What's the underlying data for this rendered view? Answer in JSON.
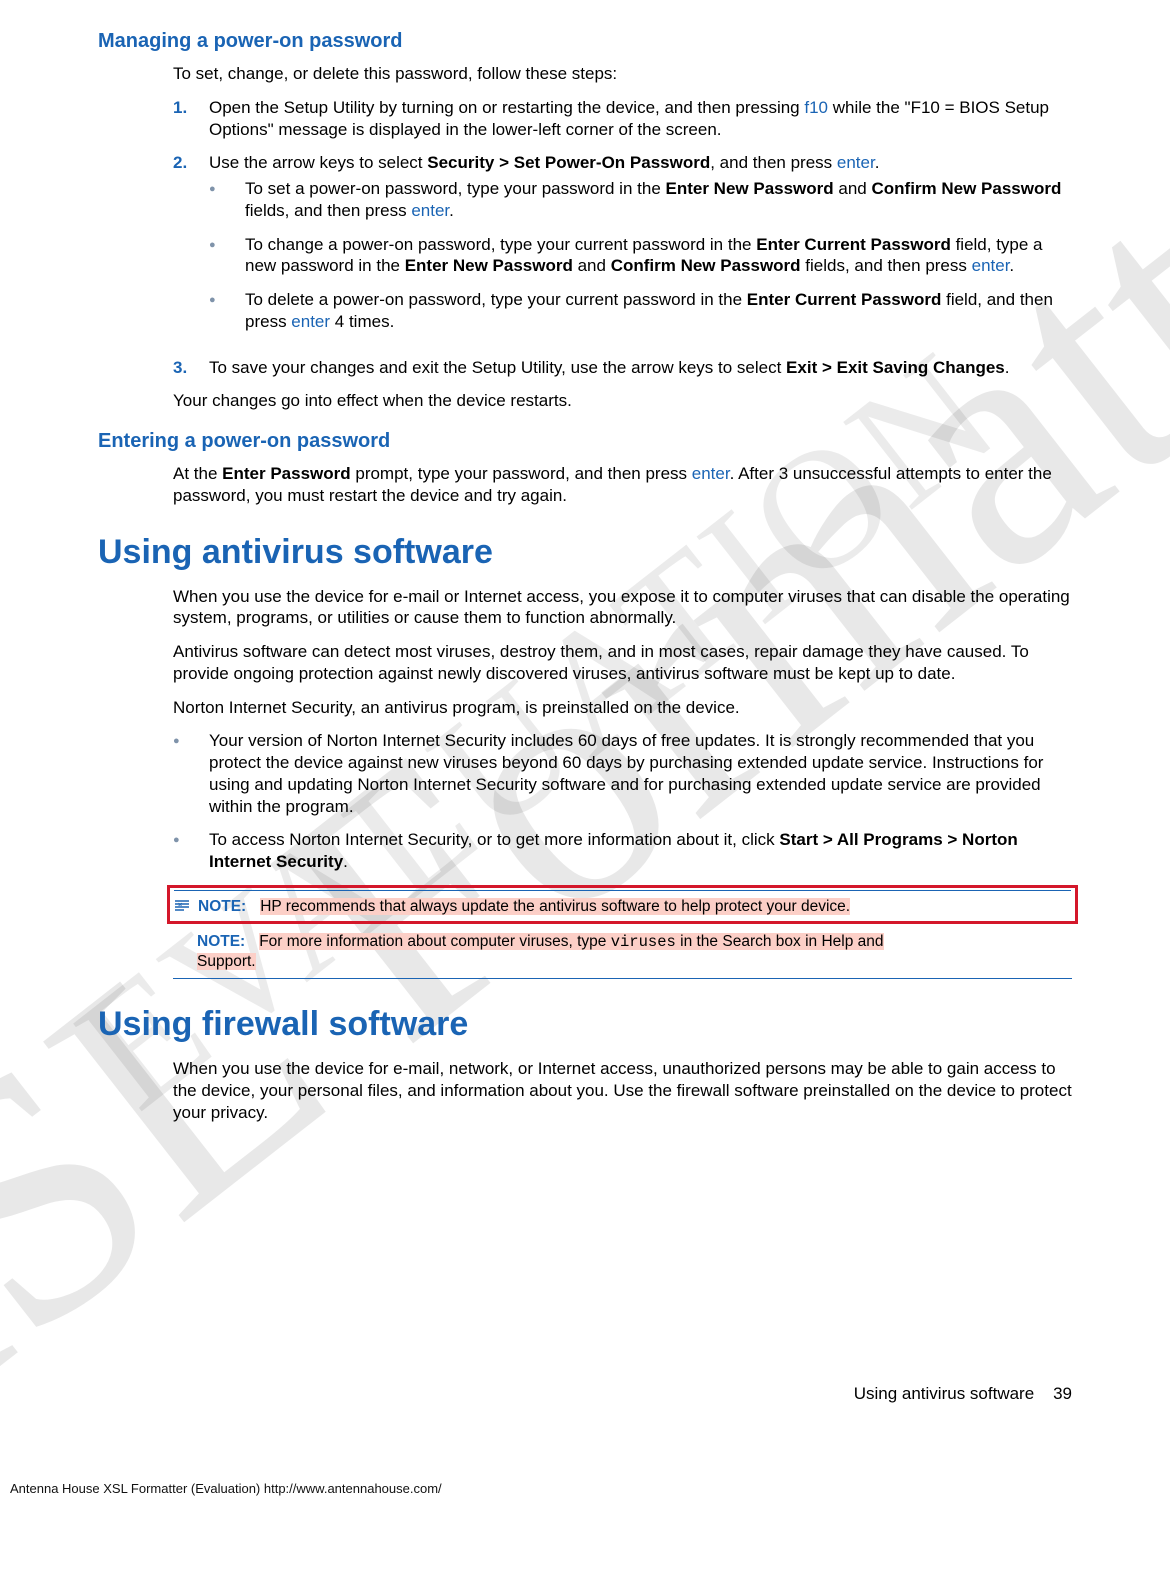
{
  "section1": {
    "heading": "Managing a power-on password",
    "intro": "To set, change, or delete this password, follow these steps:",
    "step1_num": "1.",
    "step1_a": "Open the Setup Utility by turning on or restarting the device, and then pressing ",
    "step1_key": "f10",
    "step1_b": " while the \"F10 = BIOS Setup Options\" message is displayed in the lower-left corner of the screen.",
    "step2_num": "2.",
    "step2_a": "Use the arrow keys to select ",
    "step2_bold": "Security > Set Power-On Password",
    "step2_b": ", and then press ",
    "step2_key": "enter",
    "step2_c": ".",
    "sub1_a": "To set a power-on password, type your password in the ",
    "sub1_b1": "Enter New Password",
    "sub1_c": " and ",
    "sub1_b2": "Confirm New Password",
    "sub1_d": " fields, and then press ",
    "sub1_key": "enter",
    "sub1_e": ".",
    "sub2_a": "To change a power-on password, type your current password in the ",
    "sub2_b1": "Enter Current Password",
    "sub2_c": " field, type a new password in the ",
    "sub2_b2": "Enter New Password",
    "sub2_d": " and ",
    "sub2_b3": "Confirm New Password",
    "sub2_e": " fields, and then press ",
    "sub2_key": "enter",
    "sub2_f": ".",
    "sub3_a": "To delete a power-on password, type your current password in the ",
    "sub3_b1": "Enter Current Password",
    "sub3_c": " field, and then press ",
    "sub3_key": "enter",
    "sub3_d": " 4 times.",
    "step3_num": "3.",
    "step3_a": "To save your changes and exit the Setup Utility, use the arrow keys to select ",
    "step3_bold": "Exit > Exit Saving Changes",
    "step3_b": ".",
    "outro": "Your changes go into effect when the device restarts."
  },
  "section2": {
    "heading": "Entering a power-on password",
    "p_a": "At the ",
    "p_b": "Enter Password",
    "p_c": " prompt, type your password, and then press ",
    "p_key": "enter",
    "p_d": ". After 3 unsuccessful attempts to enter the password, you must restart the device and try again."
  },
  "section3": {
    "heading": "Using antivirus software",
    "p1": "When you use the device for e-mail or Internet access, you expose it to computer viruses that can disable the operating system, programs, or utilities or cause them to function abnormally.",
    "p2": "Antivirus software can detect most viruses, destroy them, and in most cases, repair damage they have caused. To provide ongoing protection against newly discovered viruses, antivirus software must be kept up to date.",
    "p3": "Norton Internet Security, an antivirus program, is preinstalled on the device.",
    "b1": "Your version of Norton Internet Security includes 60 days of free updates. It is strongly recommended that you protect the device against new viruses beyond 60 days by purchasing extended update service. Instructions for using and updating Norton Internet Security software and for purchasing extended update service are provided within the program.",
    "b2_a": "To access Norton Internet Security, or to get more information about it, click ",
    "b2_bold": "Start > All Programs > Norton Internet Security",
    "b2_b": ".",
    "note_label": "NOTE:",
    "note1_text": "HP recommends that always update the antivirus software to help protect your device.",
    "note2_a": "For more information about computer viruses, type ",
    "note2_code": "viruses",
    "note2_b": " in the Search box in Help and ",
    "note2_c": "Support."
  },
  "section4": {
    "heading": "Using firewall software",
    "p1": "When you use the device for e-mail, network, or Internet access, unauthorized persons may be able to gain access to the device, your personal files, and information about you. Use the firewall software preinstalled on the device to protect your privacy."
  },
  "footer": {
    "right_text": "Using antivirus software",
    "page_num": "39",
    "left": "Antenna House XSL Formatter (Evaluation)  http://www.antennahouse.com/"
  },
  "watermark": {
    "big": "XSL Formatter",
    "small": "EVALUATION"
  }
}
